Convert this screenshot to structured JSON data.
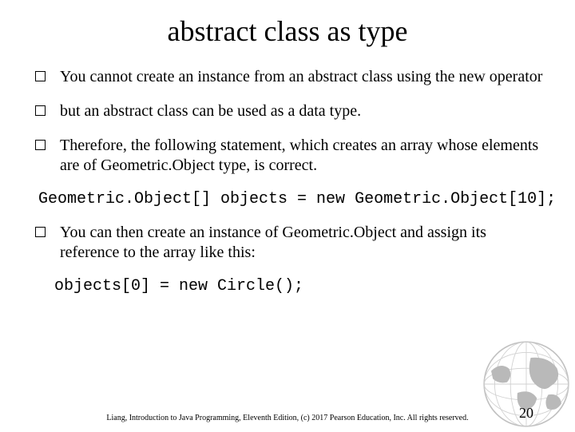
{
  "title": "abstract class as type",
  "bullets": [
    "You cannot create an instance from an abstract class using the new operator",
    "but an abstract class can be used as a data type.",
    "Therefore, the following statement, which creates an array whose elements are of Geometric.Object type, is correct."
  ],
  "code1": "Geometric.Object[] objects = new Geometric.Object[10];",
  "bullet4": "You can then create an instance of Geometric.Object and assign its reference to the array like this:",
  "code2": "objects[0] = new Circle();",
  "footer": "Liang, Introduction to Java Programming, Eleventh Edition, (c) 2017 Pearson Education, Inc. All rights reserved.",
  "page": "20"
}
